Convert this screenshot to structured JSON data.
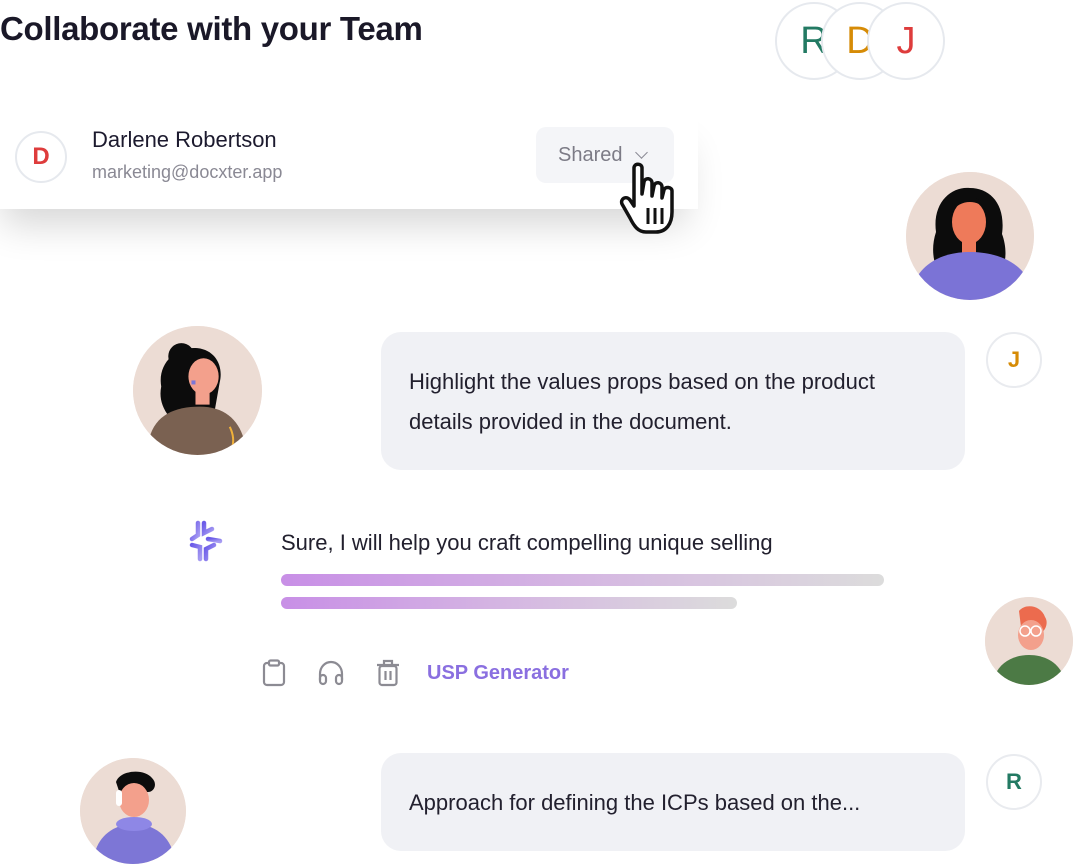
{
  "header": {
    "title": "Collaborate with your Team"
  },
  "team": {
    "members": [
      {
        "initial": "R",
        "color": "#237a63"
      },
      {
        "initial": "D",
        "color": "#d68b06"
      },
      {
        "initial": "J",
        "color": "#de3c3c"
      }
    ]
  },
  "user_card": {
    "initial": "D",
    "name": "Darlene Robertson",
    "email": "marketing@docxter.app",
    "access": "Shared",
    "access_icon": "chevron-down-icon"
  },
  "chat": {
    "messages": [
      {
        "author_initial": "J",
        "text_line1": "Highlight the values props based on the product",
        "text_line2": "details provided in the document."
      },
      {
        "author": "ai",
        "icon": "ai-sparkle-icon",
        "text": "Sure, I will help you craft compelling unique selling",
        "loading_progress": [
          1.0,
          0.76
        ]
      },
      {
        "author_initial": "R",
        "text": "Approach for defining the ICPs based on the..."
      }
    ],
    "actions": {
      "icons": [
        "clipboard-icon",
        "headphones-icon",
        "trash-icon"
      ],
      "tool_label": "USP Generator"
    }
  },
  "colors": {
    "accent": "#8a6fe0",
    "bubble": "#f0f1f5",
    "avatar_bg": "#ecdcd4"
  }
}
